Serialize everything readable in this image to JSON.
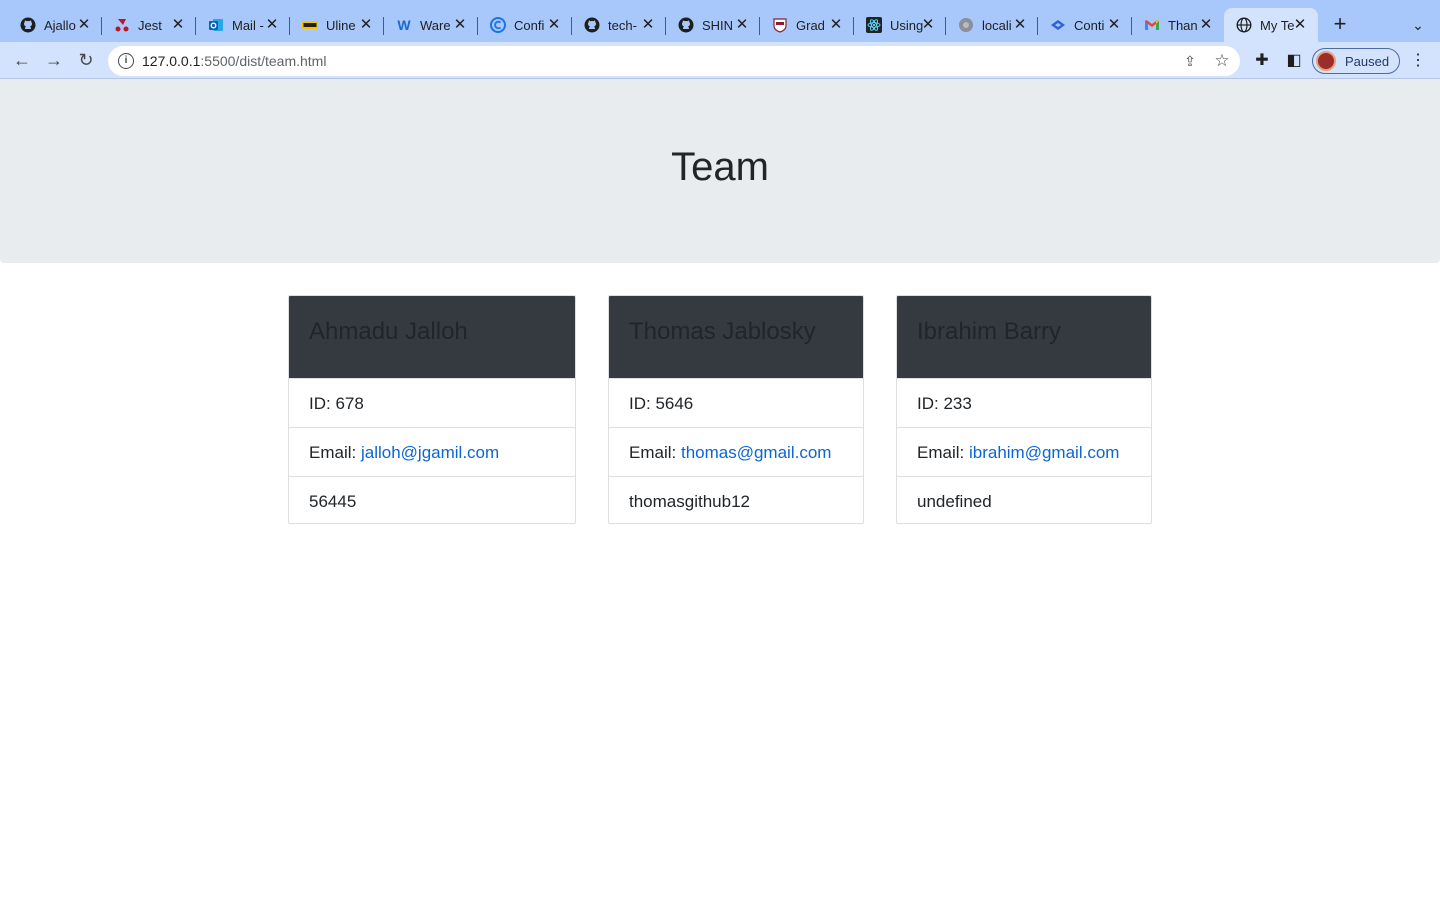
{
  "browser": {
    "tabs": [
      {
        "title": "Ajallo",
        "icon": "github-icon"
      },
      {
        "title": "Jest",
        "icon": "jest-icon"
      },
      {
        "title": "Mail -",
        "icon": "outlook-icon"
      },
      {
        "title": "Uline",
        "icon": "uline-icon"
      },
      {
        "title": "Ware",
        "icon": "w-icon"
      },
      {
        "title": "Confi",
        "icon": "c-circle-icon"
      },
      {
        "title": "tech-",
        "icon": "github-icon"
      },
      {
        "title": "SHIN",
        "icon": "github-icon"
      },
      {
        "title": "Grad",
        "icon": "shield-crest-icon"
      },
      {
        "title": "Using",
        "icon": "react-icon"
      },
      {
        "title": "locali",
        "icon": "globe-icon"
      },
      {
        "title": "Conti",
        "icon": "diamond-icon"
      },
      {
        "title": "Than",
        "icon": "gmail-icon"
      },
      {
        "title": "My Te",
        "icon": "globe-icon"
      }
    ],
    "url_host": "127.0.0.1",
    "url_rest": ":5500/dist/team.html",
    "profile_label": "Paused"
  },
  "page": {
    "title": "Team"
  },
  "team": [
    {
      "name": "Ahmadu Jalloh",
      "id_label": "ID: 678",
      "email_prefix": "Email: ",
      "email": "jalloh@jgamil.com",
      "extra": "56445"
    },
    {
      "name": "Thomas Jablosky",
      "id_label": "ID: 5646",
      "email_prefix": "Email: ",
      "email": "thomas@gmail.com",
      "extra": "thomasgithub12"
    },
    {
      "name": "Ibrahim Barry",
      "id_label": "ID: 233",
      "email_prefix": "Email: ",
      "email": "ibrahim@gmail.com",
      "extra": "undefined"
    }
  ]
}
